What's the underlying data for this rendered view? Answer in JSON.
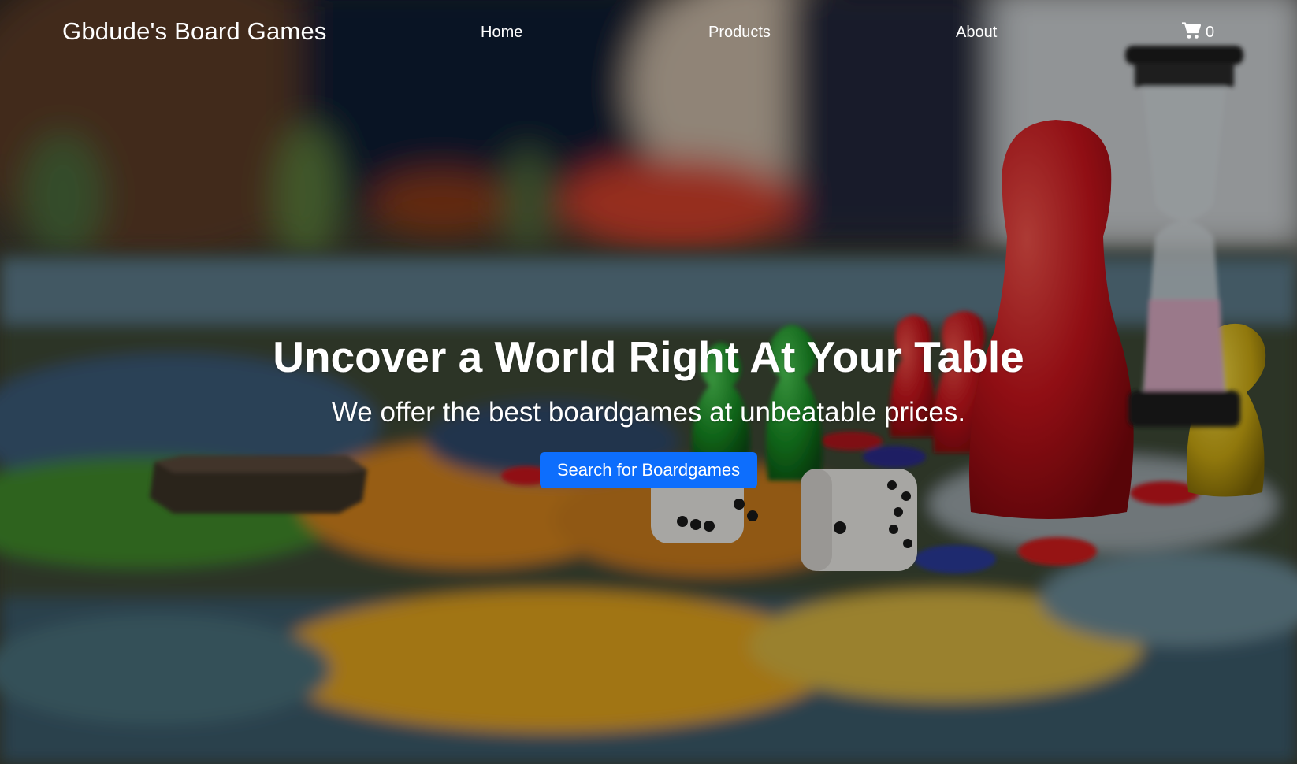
{
  "navbar": {
    "brand": "Gbdude's Board Games",
    "links": [
      {
        "label": "Home"
      },
      {
        "label": "Products"
      },
      {
        "label": "About"
      }
    ],
    "cart": {
      "icon": "shopping-cart-icon",
      "count": "0"
    }
  },
  "hero": {
    "title": "Uncover a World Right At Your Table",
    "subtitle": "We offer the best boardgames at unbeatable prices.",
    "cta_label": "Search for Boardgames"
  },
  "colors": {
    "cta_background": "#0d6efd",
    "text": "#ffffff"
  }
}
